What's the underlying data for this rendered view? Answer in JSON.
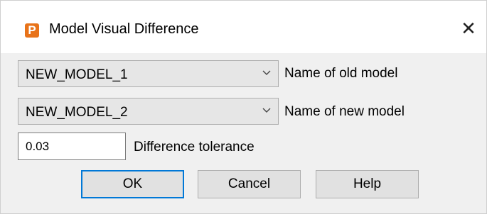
{
  "window": {
    "title": "Model Visual Difference",
    "app_icon_letter": "P",
    "close_glyph": "✕"
  },
  "form": {
    "old_model": {
      "value": "NEW_MODEL_1",
      "label": "Name of old model"
    },
    "new_model": {
      "value": "NEW_MODEL_2",
      "label": "Name of new model"
    },
    "tolerance": {
      "value": "0.03",
      "label": "Difference tolerance"
    }
  },
  "buttons": {
    "ok": "OK",
    "cancel": "Cancel",
    "help": "Help"
  },
  "colors": {
    "app_icon": "#e8731a",
    "default_button_border": "#0078d7"
  },
  "icons": [
    "app-icon",
    "close-icon",
    "chevron-down-icon"
  ]
}
